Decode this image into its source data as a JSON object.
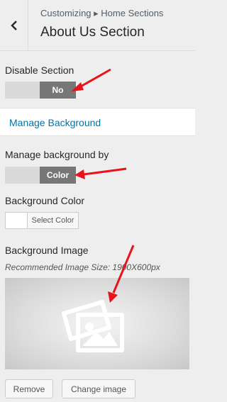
{
  "header": {
    "breadcrumb": "Customizing ▸ Home Sections",
    "title": "About Us Section"
  },
  "disable_section": {
    "label": "Disable Section",
    "value": "No"
  },
  "manage_background_link": "Manage Background",
  "manage_background_by": {
    "label": "Manage background by",
    "value": "Color"
  },
  "background_color": {
    "label": "Background Color",
    "button": "Select Color"
  },
  "background_image": {
    "label": "Background Image",
    "hint": "Recommended Image Size: 1900X600px",
    "remove_button": "Remove",
    "change_button": "Change image"
  },
  "colors": {
    "accent": "#0073aa",
    "arrow": "#e8131b",
    "toggle_on": "#777777"
  }
}
